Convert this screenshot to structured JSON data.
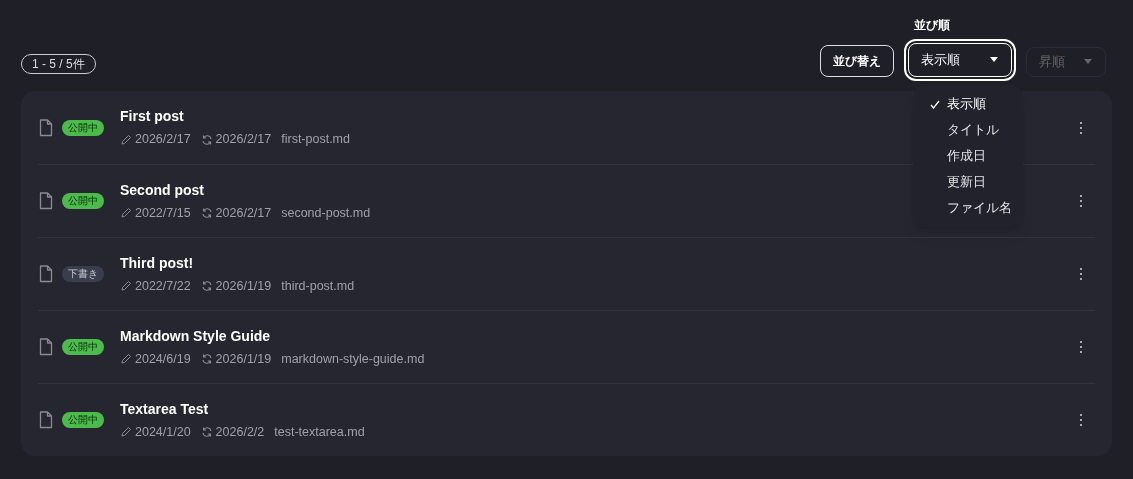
{
  "count_badge": "1 - 5 / 5件",
  "sort_button": "並び替え",
  "sort_order": {
    "label": "並び順",
    "value": "表示順",
    "expanded": true,
    "options": [
      {
        "label": "表示順",
        "selected": true
      },
      {
        "label": "タイトル",
        "selected": false
      },
      {
        "label": "作成日",
        "selected": false
      },
      {
        "label": "更新日",
        "selected": false
      },
      {
        "label": "ファイル名",
        "selected": false
      }
    ]
  },
  "direction": {
    "value": "昇順",
    "disabled": true
  },
  "posts": [
    {
      "status": {
        "label": "公開中",
        "kind": "published"
      },
      "title": "First post",
      "created": "2026/2/17",
      "updated": "2026/2/17",
      "file": "first-post.md"
    },
    {
      "status": {
        "label": "公開中",
        "kind": "published"
      },
      "title": "Second post",
      "created": "2022/7/15",
      "updated": "2026/2/17",
      "file": "second-post.md"
    },
    {
      "status": {
        "label": "下書き",
        "kind": "draft"
      },
      "title": "Third post!",
      "created": "2022/7/22",
      "updated": "2026/1/19",
      "file": "third-post.md"
    },
    {
      "status": {
        "label": "公開中",
        "kind": "published"
      },
      "title": "Markdown Style Guide",
      "created": "2024/6/19",
      "updated": "2026/1/19",
      "file": "markdown-style-guide.md"
    },
    {
      "status": {
        "label": "公開中",
        "kind": "published"
      },
      "title": "Textarea Test",
      "created": "2024/1/20",
      "updated": "2026/2/2",
      "file": "test-textarea.md"
    }
  ]
}
